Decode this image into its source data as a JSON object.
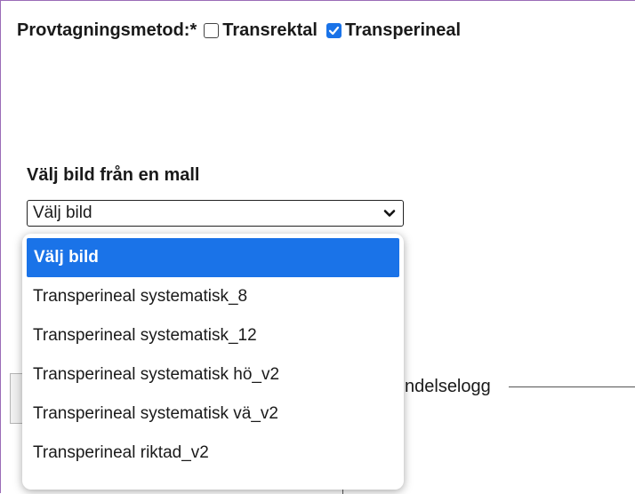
{
  "form": {
    "method_label": "Provtagningsmetod:*",
    "options": [
      {
        "label": "Transrektal",
        "checked": false
      },
      {
        "label": "Transperineal",
        "checked": true
      }
    ]
  },
  "template": {
    "heading": "Välj bild från en mall",
    "select_value": "Välj bild",
    "dropdown_options": [
      "Välj bild",
      "Transperineal systematisk_8",
      "Transperineal systematisk_12",
      "Transperineal systematisk hö_v2",
      "Transperineal systematisk vä_v2",
      "Transperineal riktad_v2"
    ]
  },
  "background": {
    "log_label": "ndelselogg"
  },
  "colors": {
    "accent": "#1a73e8",
    "frame": "#9a6cb7"
  }
}
